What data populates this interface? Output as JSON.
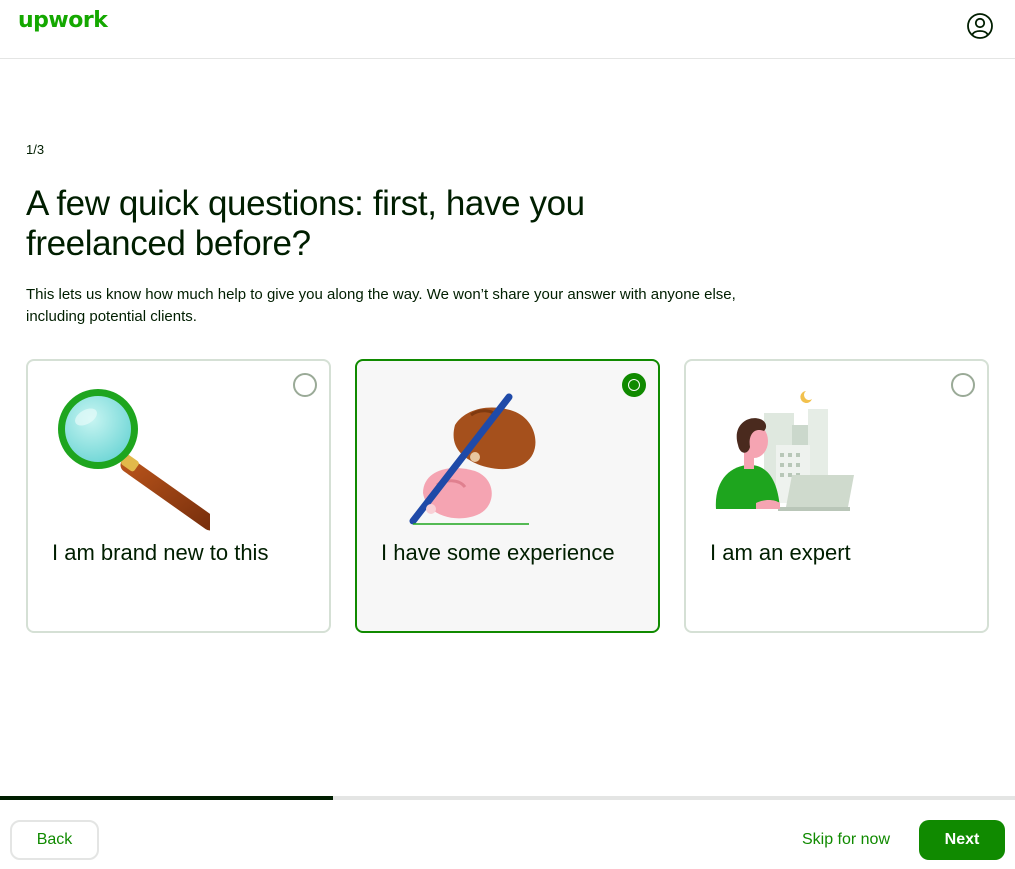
{
  "header": {
    "logo_text": "upwork",
    "account_icon": "user-circle-icon"
  },
  "step": {
    "indicator": "1/3"
  },
  "main": {
    "title": "A few quick questions: first, have you freelanced before?",
    "description": "This lets us know how much help to give you along the way. We won’t share your answer with anyone else, including potential clients."
  },
  "options": [
    {
      "label": "I am brand new to this",
      "selected": false,
      "icon": "magnifying-glass-illustration"
    },
    {
      "label": "I have some experience",
      "selected": true,
      "icon": "hands-with-pen-illustration"
    },
    {
      "label": "I am an expert",
      "selected": false,
      "icon": "person-with-laptop-illustration"
    }
  ],
  "progress": {
    "fraction": 0.328
  },
  "footer": {
    "back_label": "Back",
    "skip_label": "Skip for now",
    "next_label": "Next"
  },
  "colors": {
    "brand_green": "#14a800",
    "button_green": "#108a00",
    "text_dark": "#001e00",
    "border": "#e4e5e4"
  }
}
